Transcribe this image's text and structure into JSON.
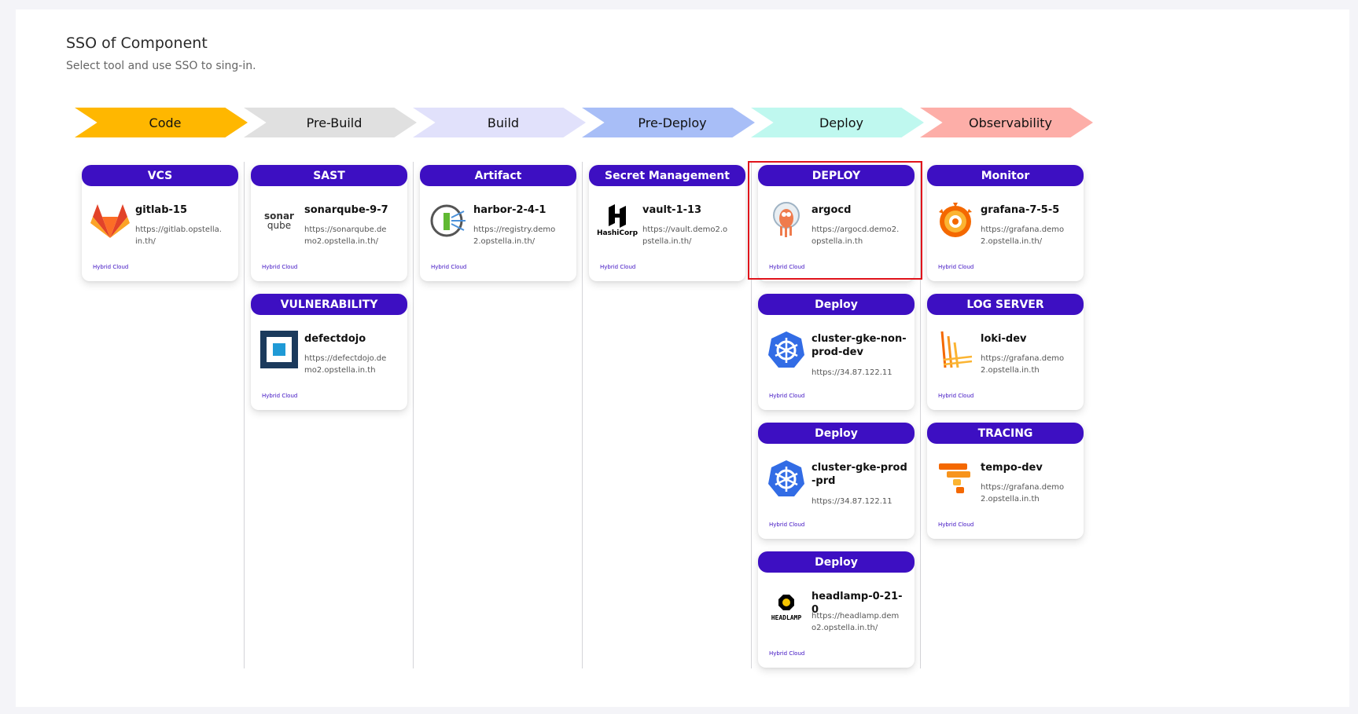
{
  "page": {
    "title": "SSO of Component",
    "subtitle": "Select tool and use SSO to sing-in."
  },
  "stages": [
    {
      "label": "Code",
      "color": "#ffb700"
    },
    {
      "label": "Pre-Build",
      "color": "#e0e0e0"
    },
    {
      "label": "Build",
      "color": "#e1e1fb"
    },
    {
      "label": "Pre-Deploy",
      "color": "#a8bef7"
    },
    {
      "label": "Deploy",
      "color": "#bff8ef"
    },
    {
      "label": "Observability",
      "color": "#fdaea8"
    }
  ],
  "columns": [
    {
      "cards": [
        {
          "category": "VCS",
          "name": "gitlab-15",
          "url": "https://gitlab.opstella.in.th/",
          "badge": "Hybrid Cloud",
          "icon": "gitlab-icon"
        }
      ]
    },
    {
      "cards": [
        {
          "category": "SAST",
          "name": "sonarqube-9-7",
          "url": "https://sonarqube.demo2.opstella.in.th/",
          "badge": "Hybrid Cloud",
          "icon": "sonarqube-icon",
          "logo_text": [
            "sonar",
            "qube"
          ]
        },
        {
          "category": "VULNERABILITY",
          "name": "defectdojo",
          "url": "https://defectdojo.demo2.opstella.in.th",
          "badge": "Hybrid Cloud",
          "icon": "defectdojo-icon"
        }
      ]
    },
    {
      "cards": [
        {
          "category": "Artifact",
          "name": "harbor-2-4-1",
          "url": "https://registry.demo2.opstella.in.th/",
          "badge": "Hybrid Cloud",
          "icon": "harbor-icon"
        }
      ]
    },
    {
      "cards": [
        {
          "category": "Secret Management",
          "name": "vault-1-13",
          "url": "https://vault.demo2.opstella.in.th/",
          "badge": "Hybrid Cloud",
          "icon": "hashicorp-vault-icon",
          "logo_text": [
            "HashiCorp"
          ]
        }
      ]
    },
    {
      "cards": [
        {
          "category": "DEPLOY",
          "name": "argocd",
          "url": "https://argocd.demo2.opstella.in.th",
          "badge": "Hybrid Cloud",
          "icon": "argocd-icon",
          "selected": true
        },
        {
          "category": "Deploy",
          "name": "cluster-gke-non-prod-dev",
          "url": "https://34.87.122.11",
          "badge": "Hybrid Cloud",
          "icon": "kubernetes-icon"
        },
        {
          "category": "Deploy",
          "name": "cluster-gke-prod-prd",
          "url": "https://34.87.122.11",
          "badge": "Hybrid Cloud",
          "icon": "kubernetes-icon"
        },
        {
          "category": "Deploy",
          "name": "headlamp-0-21-0",
          "url": "https://headlamp.demo2.opstella.in.th/",
          "badge": "Hybrid Cloud",
          "icon": "headlamp-icon",
          "logo_text": [
            "HEADLAMP"
          ]
        }
      ]
    },
    {
      "cards": [
        {
          "category": "Monitor",
          "name": "grafana-7-5-5",
          "url": "https://grafana.demo2.opstella.in.th/",
          "badge": "Hybrid Cloud",
          "icon": "grafana-icon"
        },
        {
          "category": "LOG SERVER",
          "name": "loki-dev",
          "url": "https://grafana.demo2.opstella.in.th",
          "badge": "Hybrid Cloud",
          "icon": "loki-icon"
        },
        {
          "category": "TRACING",
          "name": "tempo-dev",
          "url": "https://grafana.demo2.opstella.in.th",
          "badge": "Hybrid Cloud",
          "icon": "tempo-icon"
        }
      ]
    }
  ]
}
